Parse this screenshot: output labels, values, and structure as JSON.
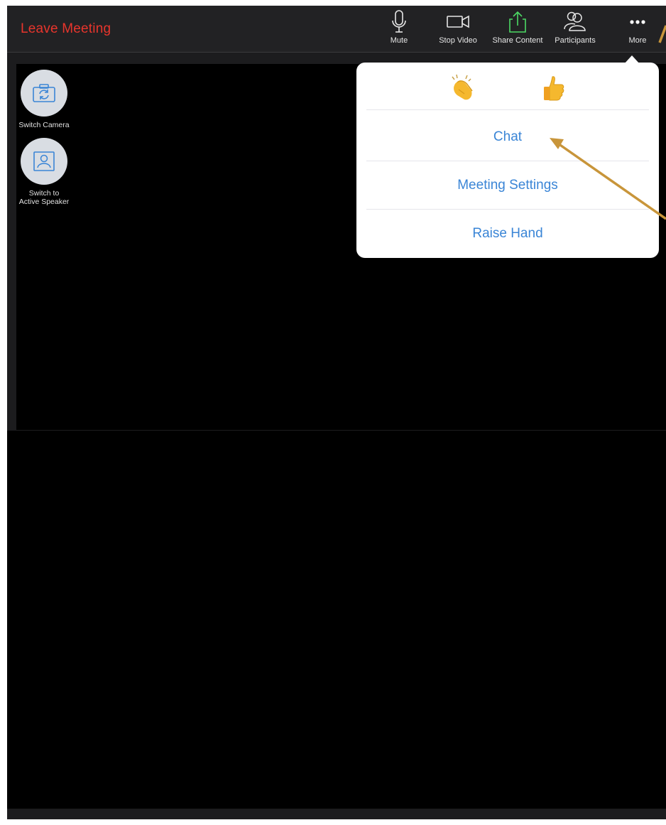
{
  "toolbar": {
    "leave_label": "Leave Meeting",
    "buttons": [
      {
        "label": "Mute",
        "icon": "microphone-icon"
      },
      {
        "label": "Stop Video",
        "icon": "video-camera-icon"
      },
      {
        "label": "Share Content",
        "icon": "share-upload-icon",
        "icon_color": "#4cd964"
      },
      {
        "label": "Participants",
        "icon": "participants-icon"
      },
      {
        "label": "More",
        "icon": "more-dots-icon"
      }
    ]
  },
  "side_controls": {
    "switch_camera_label": "Switch Camera",
    "switch_speaker_label_line1": "Switch to",
    "switch_speaker_label_line2": "Active Speaker"
  },
  "more_menu": {
    "reactions": [
      {
        "name": "clapping-hands",
        "icon": "clap-emoji-icon"
      },
      {
        "name": "thumbs-up",
        "icon": "thumbs-up-emoji-icon"
      }
    ],
    "items": [
      {
        "label": "Chat"
      },
      {
        "label": "Meeting Settings"
      },
      {
        "label": "Raise Hand"
      }
    ]
  },
  "colors": {
    "leave": "#e8352c",
    "menu_text": "#3a85d6",
    "annotation_arrow": "#c8953a",
    "background": "#000000"
  }
}
